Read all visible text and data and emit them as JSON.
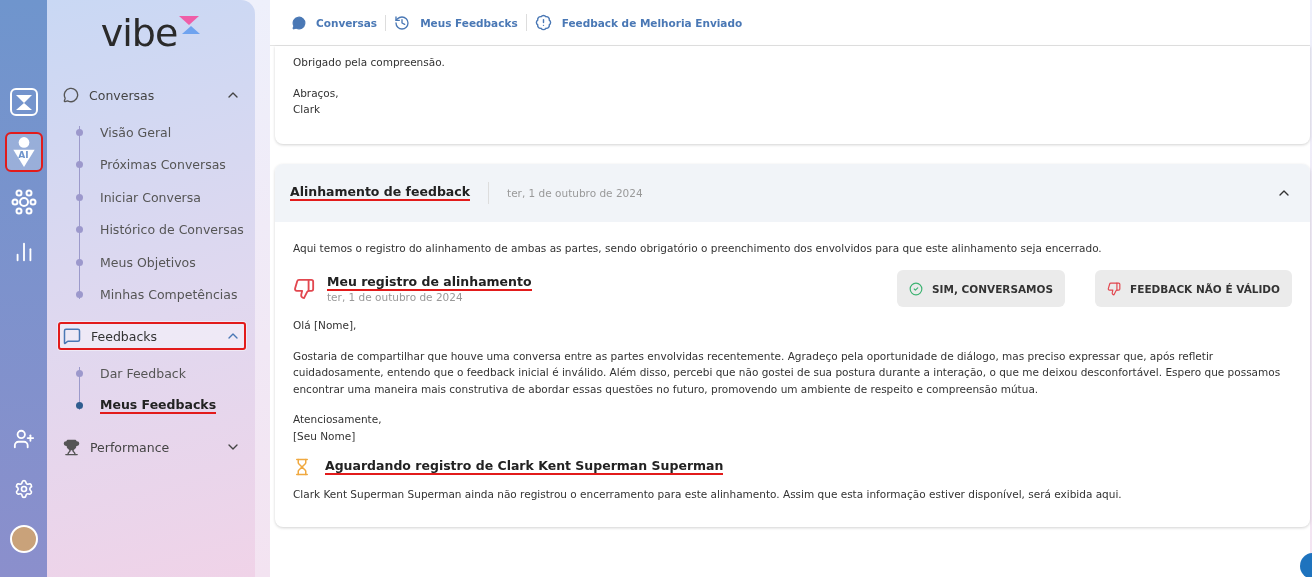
{
  "rail": {
    "items": [
      {
        "kind": "logo",
        "selected": false,
        "annotated": false
      },
      {
        "kind": "ai",
        "label": "AI",
        "selected": true,
        "annotated": true
      },
      {
        "kind": "network",
        "selected": false,
        "annotated": false
      },
      {
        "kind": "chart",
        "selected": false,
        "annotated": false
      }
    ],
    "bottom": [
      {
        "kind": "user-add"
      },
      {
        "kind": "settings"
      },
      {
        "kind": "avatar"
      }
    ]
  },
  "sidebar": {
    "logo": "vibe",
    "groups": [
      {
        "label": "Conversas",
        "kind": "chat",
        "expanded": true,
        "selected": false,
        "annotated": false,
        "children": [
          {
            "label": "Visão Geral",
            "selected": false,
            "annotated": false
          },
          {
            "label": "Próximas Conversas",
            "selected": false,
            "annotated": false
          },
          {
            "label": "Iniciar Conversa",
            "selected": false,
            "annotated": false
          },
          {
            "label": "Histórico de Conversas",
            "selected": false,
            "annotated": false
          },
          {
            "label": "Meus Objetivos",
            "selected": false,
            "annotated": false
          },
          {
            "label": "Minhas Competências",
            "selected": false,
            "annotated": false
          }
        ]
      },
      {
        "label": "Feedbacks",
        "kind": "feedback",
        "expanded": true,
        "selected": true,
        "annotated": true,
        "children": [
          {
            "label": "Dar Feedback",
            "selected": false,
            "annotated": false
          },
          {
            "label": "Meus Feedbacks",
            "selected": true,
            "annotated": true
          }
        ]
      },
      {
        "label": "Performance",
        "kind": "trophy",
        "expanded": false,
        "selected": false,
        "annotated": false
      }
    ]
  },
  "breadcrumbs": [
    {
      "kind": "chat",
      "label": "Conversas"
    },
    {
      "kind": "history",
      "label": "Meus Feedbacks"
    },
    {
      "kind": "alert",
      "label": "Feedback de Melhoria Enviado"
    }
  ],
  "previous_card": {
    "paragraphs": [
      [
        "Obrigado pela compreensão."
      ],
      [
        "Abraços,",
        "Clark"
      ]
    ]
  },
  "alignment": {
    "title": "Alinhamento de feedback",
    "title_annotated": true,
    "date": "ter, 1 de outubro de 2024",
    "expanded": true,
    "intro": "Aqui temos o registro do alinhamento de ambas as partes, sendo obrigatório o preenchimento dos envolvidos para que este alinhamento seja encerrado.",
    "my_record": {
      "title": "Meu registro de alinhamento",
      "annotated": true,
      "date": "ter, 1 de outubro de 2024",
      "buttons": [
        {
          "kind": "confirm",
          "label": "SIM, CONVERSAMOS"
        },
        {
          "kind": "reject",
          "label": "FEEDBACK NÃO É VÁLIDO"
        }
      ],
      "paragraphs": [
        [
          "Olá [Nome],"
        ],
        [
          "Gostaria de compartilhar que houve uma conversa entre as partes envolvidas recentemente. Agradeço pela oportunidade de diálogo, mas preciso expressar que, após refletir cuidadosamente, entendo que o feedback inicial é inválido. Além disso, percebi que não gostei de sua postura durante a interação, o que me deixou desconfortável. Espero que possamos encontrar uma maneira mais construtiva de abordar essas questões no futuro, promovendo um ambiente de respeito e compreensão mútua."
        ],
        [
          "Atenciosamente,",
          "[Seu Nome]"
        ]
      ]
    },
    "waiting": {
      "title": "Aguardando registro de Clark Kent Superman Superman",
      "annotated": true,
      "text": "Clark Kent Superman Superman ainda não registrou o encerramento para este alinhamento. Assim que esta informação estiver disponível, será exibida aqui."
    }
  }
}
